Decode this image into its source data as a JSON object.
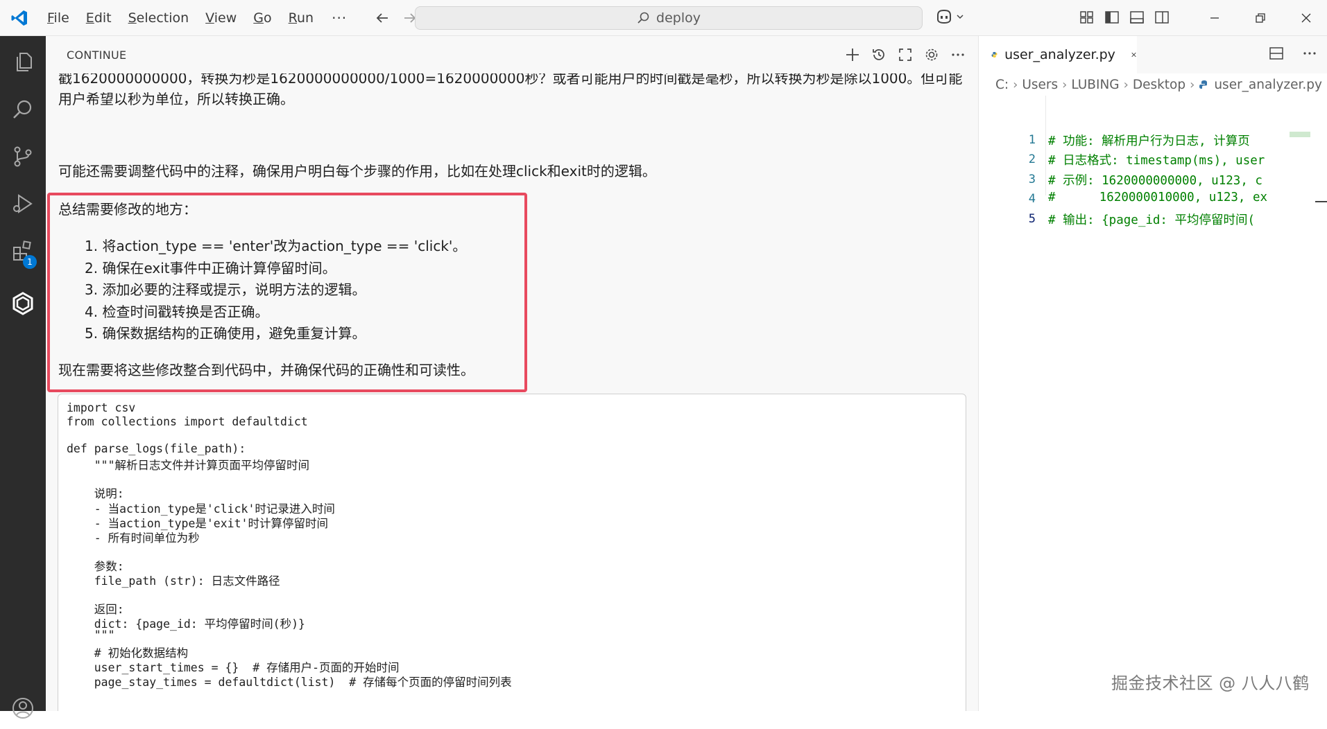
{
  "titlebar": {
    "menu": [
      {
        "pre": "",
        "mn": "F",
        "post": "ile"
      },
      {
        "pre": "",
        "mn": "E",
        "post": "dit"
      },
      {
        "pre": "",
        "mn": "S",
        "post": "election"
      },
      {
        "pre": "",
        "mn": "V",
        "post": "iew"
      },
      {
        "pre": "",
        "mn": "G",
        "post": "o"
      },
      {
        "pre": "",
        "mn": "R",
        "post": "un"
      }
    ],
    "more_label": "···",
    "search_text": "deploy"
  },
  "activity_bar": {
    "icons": [
      "explorer-icon",
      "search-icon",
      "source-control-icon",
      "run-debug-icon",
      "extensions-icon",
      "continue-icon",
      "account-icon"
    ],
    "extensions_badge": "1"
  },
  "panel": {
    "title": "CONTINUE",
    "intro_text": "戳1620000000000，转换为秒是1620000000000/1000=1620000000秒？或者可能用户的时间戳是毫秒，所以转换为秒是除以1000。但可能用户希望以秒为单位，所以转换正确。",
    "note_text": "可能还需要调整代码中的注释，确保用户明白每个步骤的作用，比如在处理click和exit时的逻辑。",
    "summary_title": "总结需要修改的地方：",
    "summary_items": [
      "1. 将action_type == 'enter'改为action_type == 'click'。",
      "2. 确保在exit事件中正确计算停留时间。",
      "3. 添加必要的注释或提示，说明方法的逻辑。",
      "4. 检查时间戳转换是否正确。",
      "5. 确保数据结构的正确使用，避免重复计算。"
    ],
    "summary_footer": "现在需要将这些修改整合到代码中，并确保代码的正确性和可读性。",
    "code_lines": [
      "import csv",
      "from collections import defaultdict",
      "",
      "def parse_logs(file_path):",
      "    \"\"\"解析日志文件并计算页面平均停留时间",
      "",
      "    说明:",
      "    - 当action_type是'click'时记录进入时间",
      "    - 当action_type是'exit'时计算停留时间",
      "    - 所有时间单位为秒",
      "",
      "    参数:",
      "    file_path (str): 日志文件路径",
      "",
      "    返回:",
      "    dict: {page_id: 平均停留时间(秒)}",
      "    \"\"\"",
      "    # 初始化数据结构",
      "    user_start_times = {}  # 存储用户-页面的开始时间",
      "    page_stay_times = defaultdict(list)  # 存储每个页面的停留时间列表"
    ]
  },
  "editor": {
    "tab_label": "user_analyzer.py",
    "breadcrumb": [
      "C:",
      "Users",
      "LUBING",
      "Desktop",
      "user_analyzer.py"
    ],
    "lines": [
      {
        "n": "1",
        "text": "# 功能: 解析用户行为日志, 计算页"
      },
      {
        "n": "2",
        "text": "# 日志格式: timestamp(ms), user"
      },
      {
        "n": "3",
        "text": "# 示例: 1620000000000, u123, c"
      },
      {
        "n": "4",
        "text": "#      1620000010000, u123, ex"
      },
      {
        "n": "5",
        "text": "# 输出: {page_id: 平均停留时间("
      }
    ]
  },
  "watermark": "掘金技术社区 @ 八人八鹤"
}
